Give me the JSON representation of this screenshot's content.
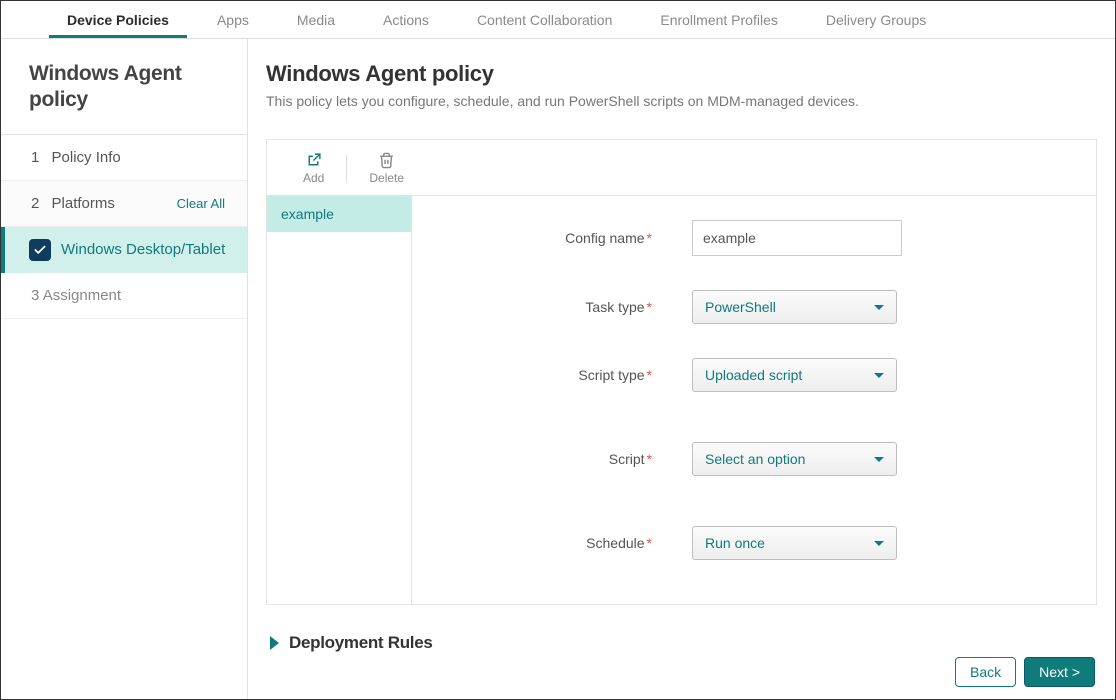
{
  "topTabs": {
    "devicePolicies": "Device Policies",
    "apps": "Apps",
    "media": "Media",
    "actions": "Actions",
    "contentCollab": "Content Collaboration",
    "enrollmentProfiles": "Enrollment Profiles",
    "deliveryGroups": "Delivery Groups"
  },
  "sidebar": {
    "title": "Windows Agent policy",
    "step1": {
      "num": "1",
      "label": "Policy Info"
    },
    "step2": {
      "num": "2",
      "label": "Platforms",
      "clearAll": "Clear All"
    },
    "platformItem": "Windows Desktop/Tablet",
    "step3": {
      "num": "3",
      "label": "Assignment"
    }
  },
  "header": {
    "title": "Windows Agent policy",
    "desc": "This policy lets you configure, schedule, and run PowerShell scripts on MDM-managed devices."
  },
  "toolbar": {
    "add": "Add",
    "delete": "Delete"
  },
  "exampleList": {
    "item0": "example"
  },
  "form": {
    "configName": {
      "label": "Config name",
      "value": "example"
    },
    "taskType": {
      "label": "Task type",
      "value": "PowerShell"
    },
    "scriptType": {
      "label": "Script type",
      "value": "Uploaded script"
    },
    "script": {
      "label": "Script",
      "value": "Select an option"
    },
    "schedule": {
      "label": "Schedule",
      "value": "Run once"
    }
  },
  "deploymentRules": "Deployment Rules",
  "buttons": {
    "back": "Back",
    "next": "Next >"
  }
}
